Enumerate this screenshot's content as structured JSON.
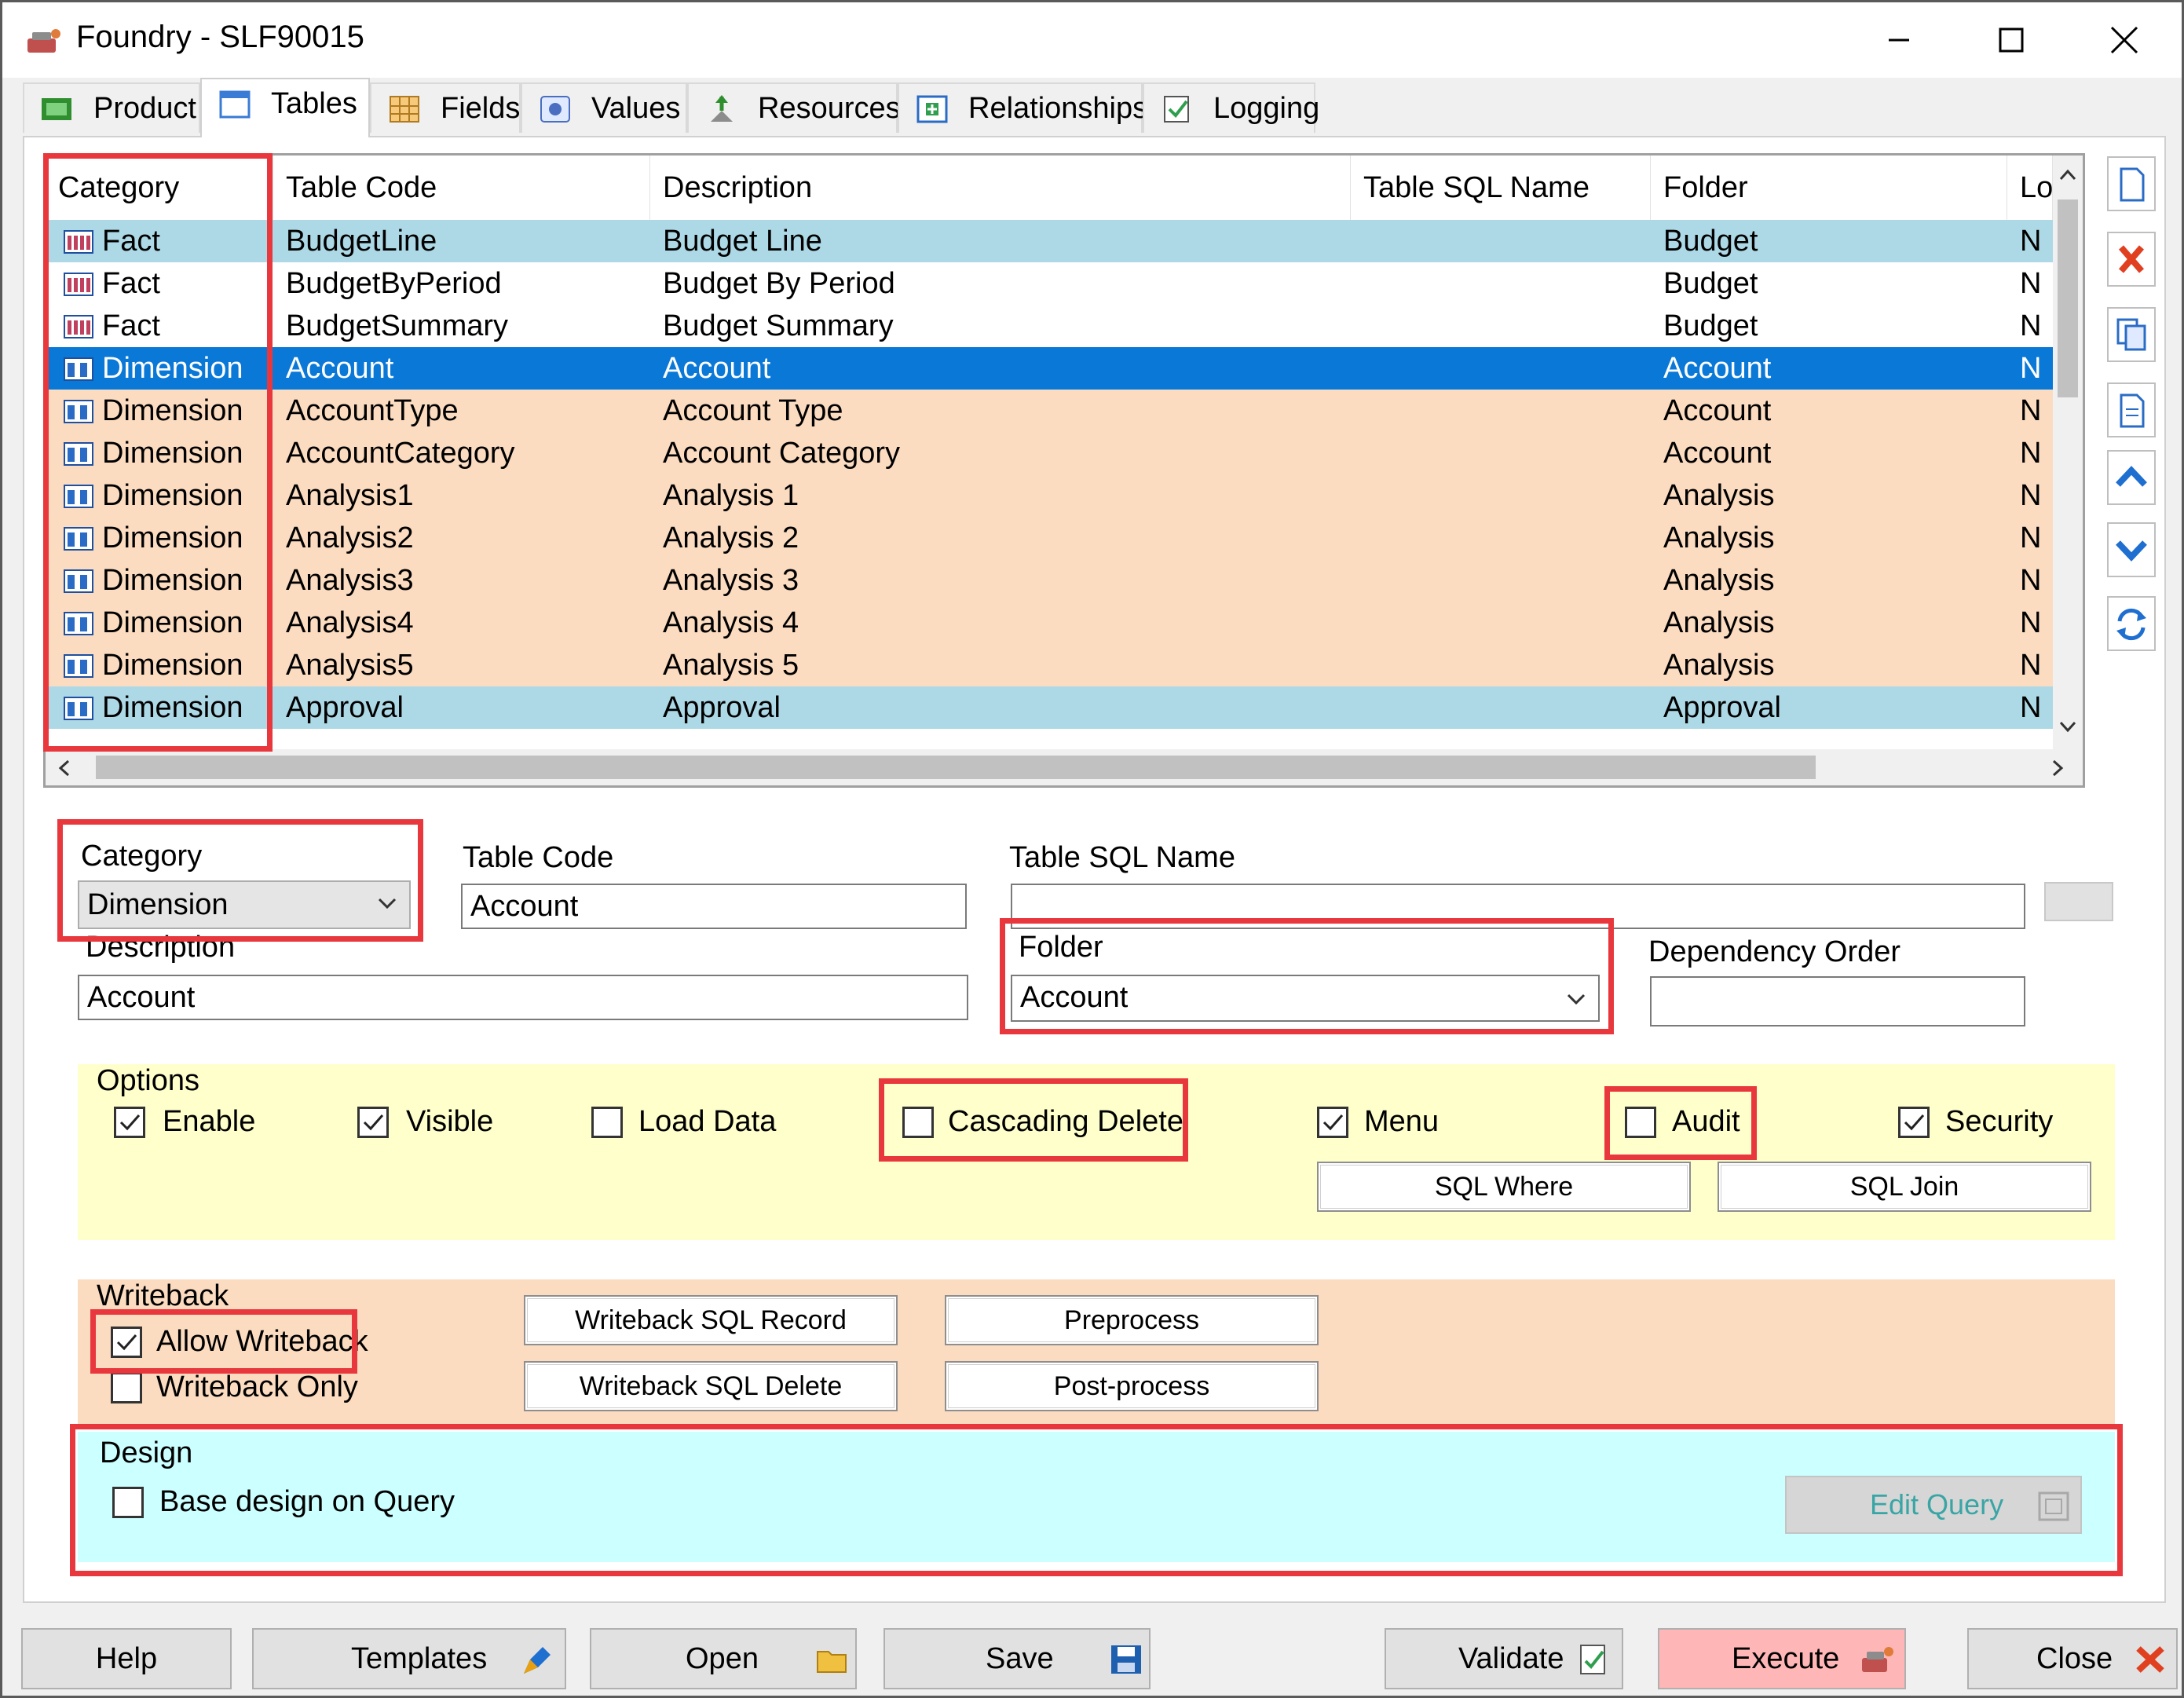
{
  "window": {
    "title": "Foundry - SLF90015"
  },
  "tabs": [
    {
      "label": "Product",
      "icon": "product-icon"
    },
    {
      "label": "Tables",
      "icon": "tables-icon"
    },
    {
      "label": "Fields",
      "icon": "fields-icon"
    },
    {
      "label": "Values",
      "icon": "values-icon"
    },
    {
      "label": "Resources",
      "icon": "resources-icon"
    },
    {
      "label": "Relationships",
      "icon": "relationships-icon"
    },
    {
      "label": "Logging",
      "icon": "logging-icon"
    }
  ],
  "grid": {
    "columns": [
      "Category",
      "Table Code",
      "Description",
      "Table SQL Name",
      "Folder",
      "Lo"
    ],
    "rows": [
      {
        "category": "Fact",
        "code": "BudgetLine",
        "description": "Budget Line",
        "sql": "",
        "folder": "Budget",
        "lo": "N"
      },
      {
        "category": "Fact",
        "code": "BudgetByPeriod",
        "description": "Budget By Period",
        "sql": "",
        "folder": "Budget",
        "lo": "N"
      },
      {
        "category": "Fact",
        "code": "BudgetSummary",
        "description": "Budget Summary",
        "sql": "",
        "folder": "Budget",
        "lo": "N"
      },
      {
        "category": "Dimension",
        "code": "Account",
        "description": "Account",
        "sql": "",
        "folder": "Account",
        "lo": "N"
      },
      {
        "category": "Dimension",
        "code": "AccountType",
        "description": "Account Type",
        "sql": "",
        "folder": "Account",
        "lo": "N"
      },
      {
        "category": "Dimension",
        "code": "AccountCategory",
        "description": "Account Category",
        "sql": "",
        "folder": "Account",
        "lo": "N"
      },
      {
        "category": "Dimension",
        "code": "Analysis1",
        "description": "Analysis 1",
        "sql": "",
        "folder": "Analysis",
        "lo": "N"
      },
      {
        "category": "Dimension",
        "code": "Analysis2",
        "description": "Analysis 2",
        "sql": "",
        "folder": "Analysis",
        "lo": "N"
      },
      {
        "category": "Dimension",
        "code": "Analysis3",
        "description": "Analysis 3",
        "sql": "",
        "folder": "Analysis",
        "lo": "N"
      },
      {
        "category": "Dimension",
        "code": "Analysis4",
        "description": "Analysis 4",
        "sql": "",
        "folder": "Analysis",
        "lo": "N"
      },
      {
        "category": "Dimension",
        "code": "Analysis5",
        "description": "Analysis 5",
        "sql": "",
        "folder": "Analysis",
        "lo": "N"
      },
      {
        "category": "Dimension",
        "code": "Approval",
        "description": "Approval",
        "sql": "",
        "folder": "Approval",
        "lo": "N"
      }
    ],
    "selected_row": 3
  },
  "form": {
    "category_label": "Category",
    "category_value": "Dimension",
    "table_code_label": "Table Code",
    "table_code_value": "Account",
    "table_sql_name_label": "Table SQL Name",
    "table_sql_name_value": "",
    "description_label": "Description",
    "description_value": "Account",
    "folder_label": "Folder",
    "folder_value": "Account",
    "dependency_order_label": "Dependency Order",
    "dependency_order_value": ""
  },
  "options": {
    "legend": "Options",
    "enable": {
      "label": "Enable",
      "checked": true
    },
    "visible": {
      "label": "Visible",
      "checked": true
    },
    "load_data": {
      "label": "Load Data",
      "checked": false
    },
    "cascading_delete": {
      "label": "Cascading Delete",
      "checked": false
    },
    "menu": {
      "label": "Menu",
      "checked": true
    },
    "audit": {
      "label": "Audit",
      "checked": false
    },
    "security": {
      "label": "Security",
      "checked": true
    },
    "sql_where_label": "SQL Where",
    "sql_join_label": "SQL Join"
  },
  "writeback": {
    "legend": "Writeback",
    "allow_writeback": {
      "label": "Allow Writeback",
      "checked": true
    },
    "writeback_only": {
      "label": "Writeback Only",
      "checked": false
    },
    "sql_record_label": "Writeback SQL Record",
    "sql_delete_label": "Writeback SQL Delete",
    "preprocess_label": "Preprocess",
    "postprocess_label": "Post-process"
  },
  "design": {
    "legend": "Design",
    "base_design": {
      "label": "Base design on Query",
      "checked": false
    },
    "edit_query_label": "Edit Query"
  },
  "bottom": {
    "help": "Help",
    "templates": "Templates",
    "open": "Open",
    "save": "Save",
    "validate": "Validate",
    "execute": "Execute",
    "close": "Close"
  },
  "colors": {
    "fact_row": "#ffffff",
    "dimension_row": "#fcdcc0",
    "highlight_row": "#add8e6",
    "selected_row": "#0a78d7",
    "options_bg": "#ffffcc",
    "writeback_bg": "#fcdcc0",
    "design_bg": "#ccffff",
    "annotation_red": "#e8383d"
  }
}
